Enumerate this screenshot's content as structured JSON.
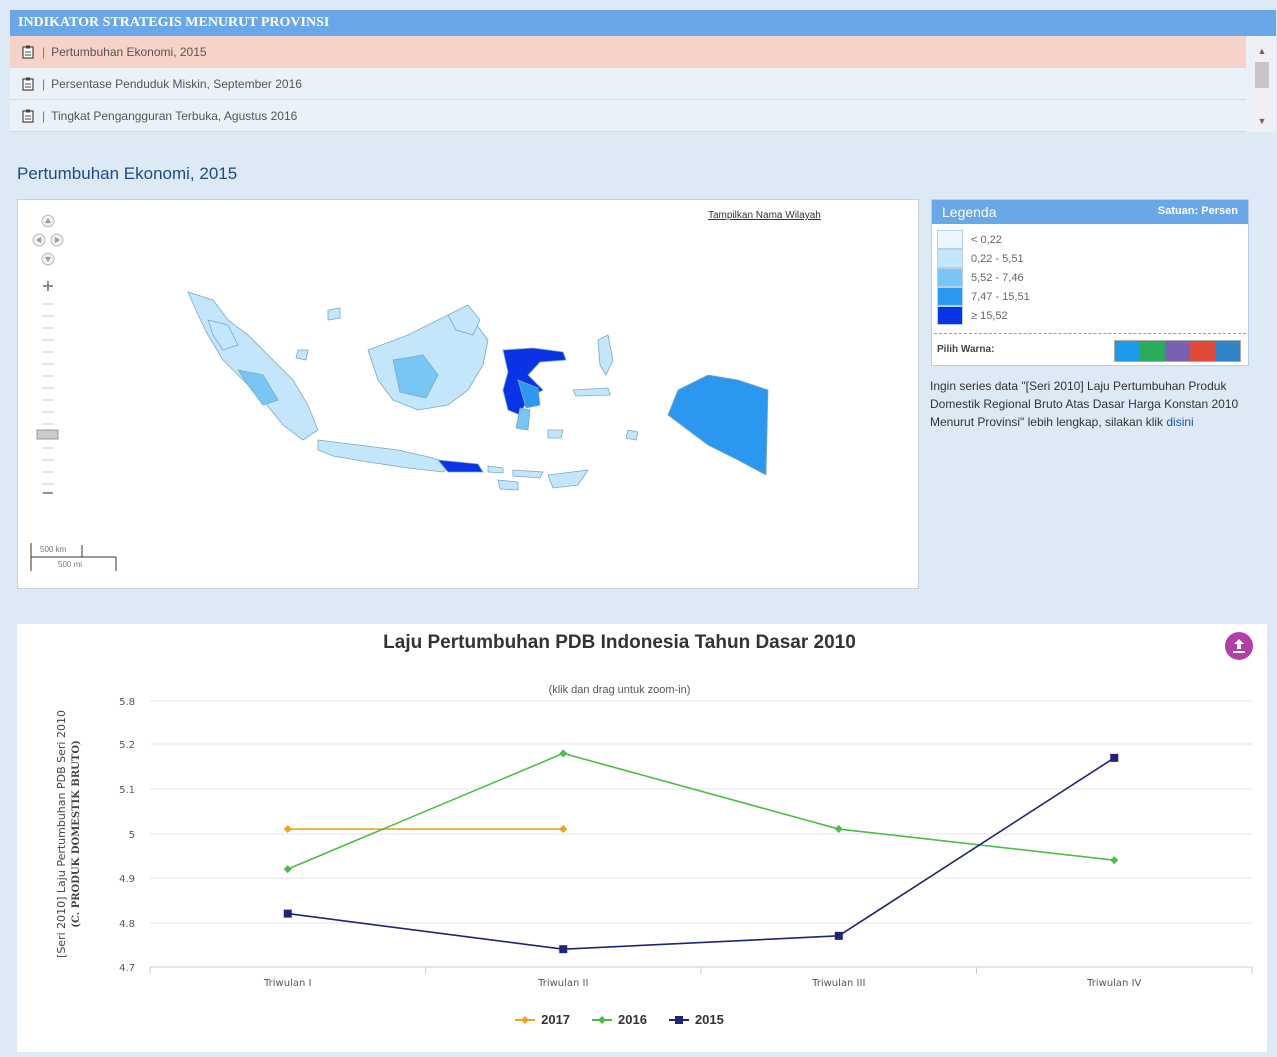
{
  "panel": {
    "title": "INDIKATOR STRATEGIS MENURUT PROVINSI",
    "items": [
      {
        "label": "Pertumbuhan Ekonomi, 2015",
        "active": true
      },
      {
        "label": "Persentase Penduduk Miskin, September 2016",
        "active": false
      },
      {
        "label": "Tingkat Pengangguran Terbuka, Agustus 2016",
        "active": false
      }
    ],
    "separator": "|"
  },
  "section_title": "Pertumbuhan Ekonomi, 2015",
  "map": {
    "show_names_link": "Tampilkan Nama Wilayah",
    "scale_km": "500 km",
    "scale_mi": "500 mi"
  },
  "legend": {
    "title": "Legenda",
    "unit": "Satuan: Persen",
    "items": [
      {
        "label": "< 0,22",
        "color": "#eaf6fd"
      },
      {
        "label": "0,22 - 5,51",
        "color": "#c3e6fa"
      },
      {
        "label": "5,52 - 7,46",
        "color": "#78c6f4"
      },
      {
        "label": "7,47 - 15,51",
        "color": "#2c97ef"
      },
      {
        "label": "≥ 15,52",
        "color": "#0b33e6"
      }
    ],
    "pick_color_label": "Pilih Warna:",
    "palette": [
      "#1e9be8",
      "#2bab5c",
      "#7c5fb3",
      "#e04a3a",
      "#2f85c8"
    ]
  },
  "more_info": {
    "text": "Ingin series data \"[Seri 2010] Laju Pertumbuhan Produk Domestik Regional Bruto Atas Dasar Harga Konstan 2010 Menurut Provinsi\" lebih lengkap, silakan klik ",
    "link": "disini"
  },
  "chart_data": {
    "type": "line",
    "title": "Laju Pertumbuhan PDB Indonesia Tahun Dasar 2010",
    "subtitle": "(klik dan drag untuk zoom-in)",
    "ylabel_line1": "[Seri 2010] Laju Pertumbuhan PDB Seri 2010",
    "ylabel_line2": "(C. PRODUK DOMESTIK BRUTO)",
    "categories": [
      "Triwulan I",
      "Triwulan II",
      "Triwulan III",
      "Triwulan IV"
    ],
    "y_ticks": [
      4.7,
      4.8,
      4.9,
      5,
      5.1,
      5.2,
      5.8
    ],
    "y_tick_labels": [
      "4.7",
      "4.8",
      "4.9",
      "5",
      "5.1",
      "5.2",
      "5.8"
    ],
    "series": [
      {
        "name": "2017",
        "color": "#f0a21e",
        "marker": "diamond",
        "values": [
          5.01,
          5.01,
          null,
          null
        ]
      },
      {
        "name": "2016",
        "color": "#4cbd4a",
        "marker": "diamond",
        "values": [
          4.92,
          5.18,
          5.01,
          4.94
        ]
      },
      {
        "name": "2015",
        "color": "#1f2576",
        "marker": "square",
        "values": [
          4.82,
          4.74,
          4.77,
          5.17
        ]
      }
    ],
    "grid": true,
    "legend_position": "bottom"
  }
}
